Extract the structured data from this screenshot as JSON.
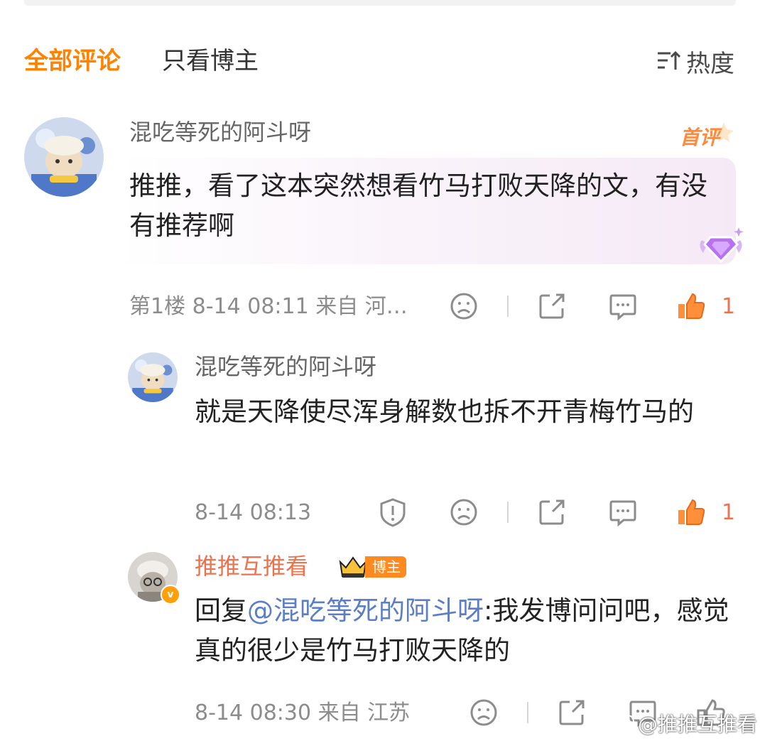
{
  "tabs": {
    "all": "全部评论",
    "blogger_only": "只看博主"
  },
  "sort": {
    "label": "热度",
    "icon": "sort-icon"
  },
  "accent_color": "#ff8200",
  "like_color": "#eb7350",
  "comments": [
    {
      "user": "混吃等死的阿斗呀",
      "badge": "首评",
      "text": "推推，看了这本突然想看竹马打败天降的文，有没有推荐啊",
      "meta": "第1楼 8-14 08:11 来自 河…",
      "likes": "1"
    },
    {
      "user": "混吃等死的阿斗呀",
      "text": "就是天降使尽浑身解数也拆不开青梅竹马的",
      "meta": "8-14 08:13",
      "likes": "1"
    },
    {
      "user": "推推互推看",
      "tag": "博主",
      "reply_prefix": "回复",
      "mention": "@混吃等死的阿斗呀",
      "text": ":我发博问问吧，感觉真的很少是竹马打败天降的",
      "meta": "8-14 08:30 来自 江苏"
    }
  ],
  "watermark": "@推推互推看"
}
